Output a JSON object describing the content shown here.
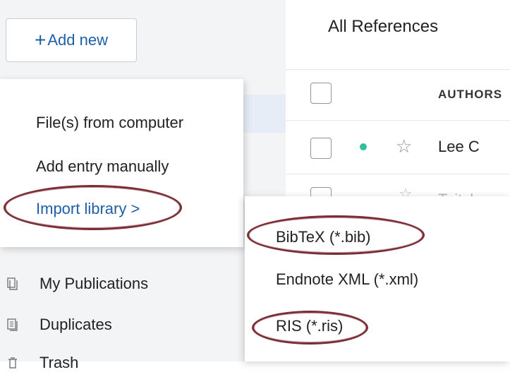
{
  "sidebar": {
    "add_new_label": "Add new",
    "items": [
      {
        "label": "My Publications",
        "icon": "publications-icon"
      },
      {
        "label": "Duplicates",
        "icon": "duplicates-icon"
      },
      {
        "label": "Trash",
        "icon": "trash-icon"
      }
    ]
  },
  "add_menu": {
    "items": [
      {
        "label": "File(s) from computer"
      },
      {
        "label": "Add entry manually"
      }
    ],
    "import_label": "Import library",
    "import_chevron": ">"
  },
  "import_submenu": {
    "items": [
      {
        "label": "BibTeX (*.bib)"
      },
      {
        "label": "Endnote XML (*.xml)"
      },
      {
        "label": "RIS (*.ris)"
      }
    ]
  },
  "main": {
    "title": "All References",
    "columns": [
      "AUTHORS"
    ],
    "rows": [
      {
        "author": "Lee C"
      },
      {
        "author": "Teitch..."
      }
    ]
  },
  "colors": {
    "accent": "#1f5fa8",
    "annotation": "#7b2d35",
    "status_dot": "#2fbf9c"
  }
}
